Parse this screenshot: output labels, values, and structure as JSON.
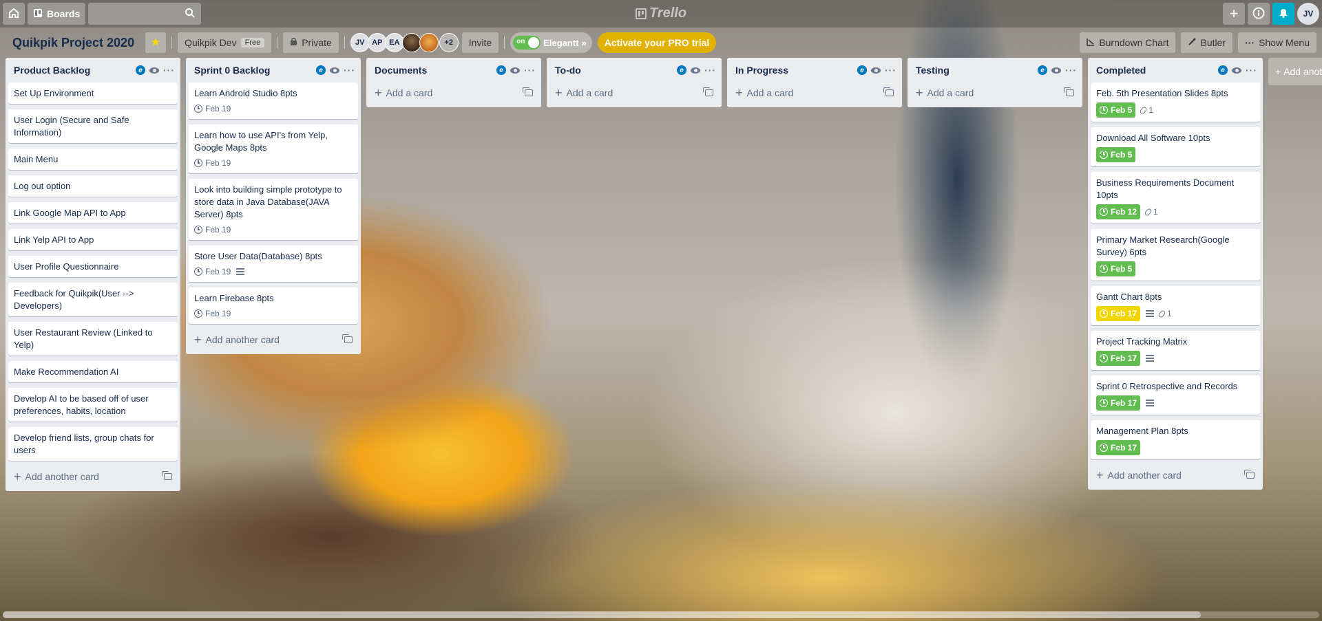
{
  "topbar": {
    "boards_label": "Boards",
    "logo_text": "Trello",
    "user_initials": "JV"
  },
  "board": {
    "title": "Quikpik Project 2020",
    "team_name": "Quikpik Dev",
    "team_badge": "Free",
    "visibility": "Private",
    "members": [
      "JV",
      "AP",
      "EA"
    ],
    "members_more": "+2",
    "invite_label": "Invite",
    "elegantt_toggle": "on",
    "elegantt_label": "Elegantt",
    "pro_trial_label": "Activate your PRO trial",
    "burndown_label": "Burndown Chart",
    "butler_label": "Butler",
    "show_menu_label": "Show Menu"
  },
  "lists": [
    {
      "title": "Product Backlog",
      "cards": [
        {
          "title": "Set Up Environment"
        },
        {
          "title": "User Login (Secure and Safe Information)"
        },
        {
          "title": "Main Menu"
        },
        {
          "title": "Log out option"
        },
        {
          "title": "Link Google Map API to App"
        },
        {
          "title": "Link Yelp API to App"
        },
        {
          "title": "User Profile Questionnaire"
        },
        {
          "title": "Feedback for Quikpik(User --> Developers)"
        },
        {
          "title": "User Restaurant Review (Linked to Yelp)"
        },
        {
          "title": "Make Recommendation AI"
        },
        {
          "title": "Develop AI to be based off of user preferences, habits, location"
        },
        {
          "title": "Develop friend lists, group chats for users"
        }
      ],
      "add_label": "Add another card"
    },
    {
      "title": "Sprint 0 Backlog",
      "cards": [
        {
          "title": "Learn Android Studio 8pts",
          "due": "Feb 19"
        },
        {
          "title": "Learn how to use API's from Yelp, Google Maps 8pts",
          "due": "Feb 19"
        },
        {
          "title": "Look into building simple prototype to store data in Java Database(JAVA Server) 8pts",
          "due": "Feb 19"
        },
        {
          "title": "Store User Data(Database) 8pts",
          "due": "Feb 19",
          "desc": true
        },
        {
          "title": "Learn Firebase 8pts",
          "due": "Feb 19"
        }
      ],
      "add_label": "Add another card"
    },
    {
      "title": "Documents",
      "cards": [],
      "add_label": "Add a card"
    },
    {
      "title": "To-do",
      "cards": [],
      "add_label": "Add a card"
    },
    {
      "title": "In Progress",
      "cards": [],
      "add_label": "Add a card"
    },
    {
      "title": "Testing",
      "cards": [],
      "add_label": "Add a card"
    },
    {
      "title": "Completed",
      "cards": [
        {
          "title": "Feb. 5th Presentation Slides 8pts",
          "due": "Feb 5",
          "due_status": "green",
          "attachments": "1"
        },
        {
          "title": "Download All Software 10pts",
          "due": "Feb 5",
          "due_status": "green"
        },
        {
          "title": "Business Requirements Document 10pts",
          "due": "Feb 12",
          "due_status": "green",
          "attachments": "1"
        },
        {
          "title": "Primary Market Research(Google Survey) 6pts",
          "due": "Feb 5",
          "due_status": "green"
        },
        {
          "title": "Gantt Chart 8pts",
          "due": "Feb 17",
          "due_status": "yellow",
          "desc": true,
          "attachments": "1"
        },
        {
          "title": "Project Tracking Matrix",
          "due": "Feb 17",
          "due_status": "green",
          "desc": true
        },
        {
          "title": "Sprint 0 Retrospective and Records",
          "due": "Feb 17",
          "due_status": "green",
          "desc": true
        },
        {
          "title": "Management Plan 8pts",
          "due": "Feb 17",
          "due_status": "green"
        }
      ],
      "add_label": "Add another card"
    }
  ],
  "add_list_label": "Add another list"
}
